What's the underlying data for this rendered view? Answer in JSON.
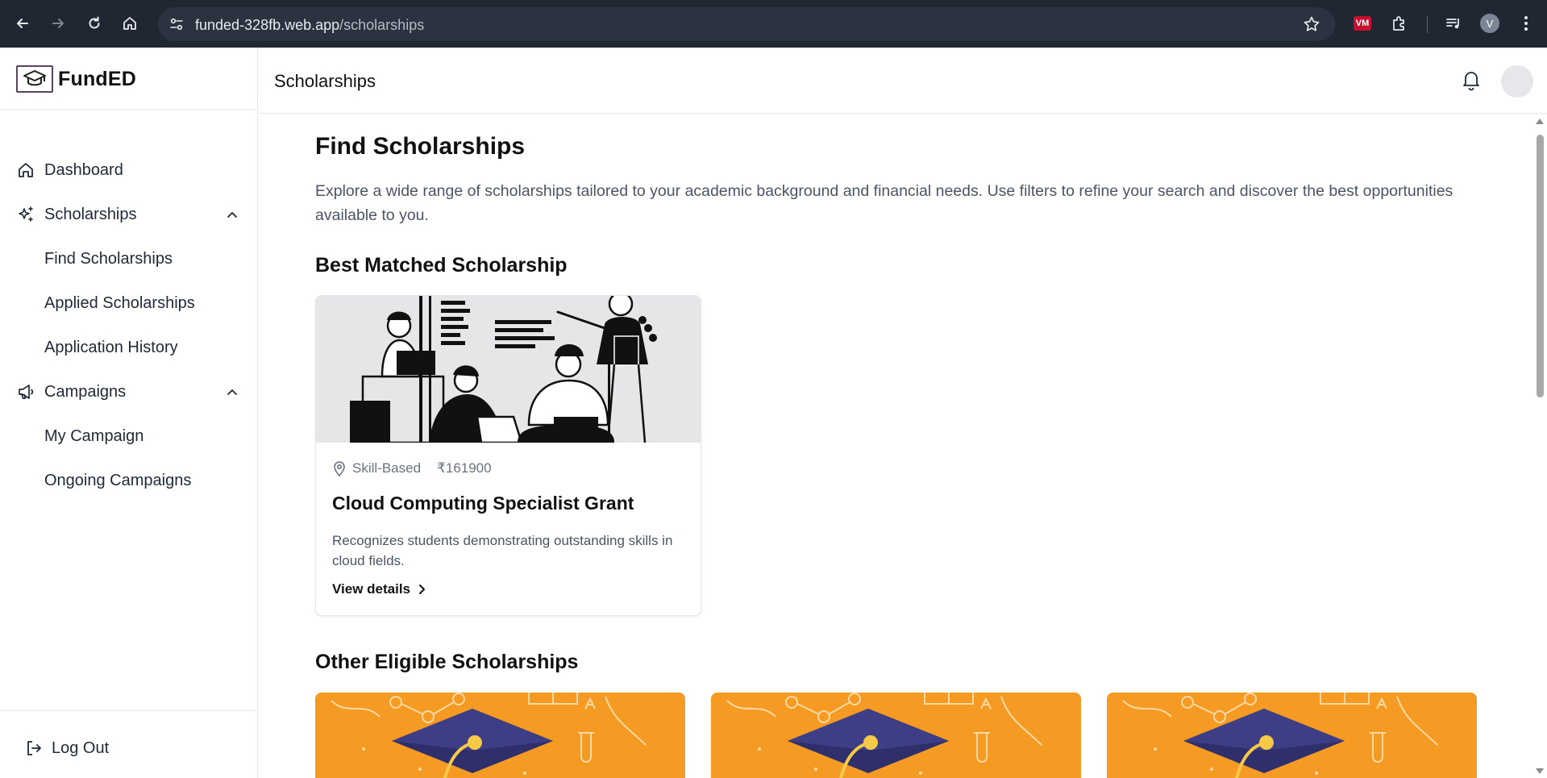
{
  "browser": {
    "url_host": "funded-328fb.web.app",
    "url_path": "/scholarships",
    "profile_initial": "V",
    "extension_badge": "VM"
  },
  "sidebar": {
    "logo_text": "FundED",
    "items": [
      {
        "label": "Dashboard",
        "icon": "home-icon"
      },
      {
        "label": "Scholarships",
        "icon": "sparkles-icon",
        "expanded": true,
        "children": [
          {
            "label": "Find Scholarships"
          },
          {
            "label": "Applied Scholarships"
          },
          {
            "label": "Application History"
          }
        ]
      },
      {
        "label": "Campaigns",
        "icon": "megaphone-icon",
        "expanded": true,
        "children": [
          {
            "label": "My Campaign"
          },
          {
            "label": "Ongoing Campaigns"
          }
        ]
      }
    ],
    "logout_label": "Log Out"
  },
  "topbar": {
    "title": "Scholarships"
  },
  "main": {
    "heading": "Find Scholarships",
    "description": "Explore a wide range of scholarships tailored to your academic background and financial needs. Use filters to refine your search and discover the best opportunities available to you.",
    "best_matched_heading": "Best Matched Scholarship",
    "best_card": {
      "category": "Skill-Based",
      "amount": "₹161900",
      "title": "Cloud Computing Specialist Grant",
      "description": "Recognizes students demonstrating outstanding skills in cloud fields.",
      "link_label": "View details"
    },
    "other_heading": "Other Eligible Scholarships"
  },
  "colors": {
    "accent_orange": "#f59a23",
    "cap_navy": "#2e2f6b",
    "chrome_dark": "#202733"
  }
}
